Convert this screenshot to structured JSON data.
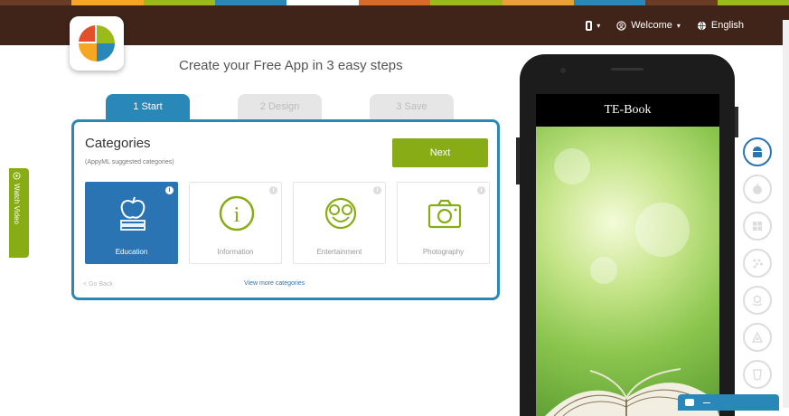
{
  "colors": {
    "stripe": [
      "#6a3c26",
      "#f5a623",
      "#9bbb1a",
      "#2a88b8",
      "#ffffff",
      "#d86a2b",
      "#9bbb1a",
      "#e8a23a",
      "#2a88b8",
      "#6a3c26",
      "#9bbb1a"
    ],
    "topbar": "#40241a",
    "accent_blue": "#2a88b8",
    "accent_green": "#88ad14"
  },
  "header": {
    "device_menu_icon": "phone-icon",
    "welcome_label": "Welcome",
    "language_label": "English"
  },
  "hero": {
    "tagline": "Create your Free App in 3 easy steps"
  },
  "steps": [
    {
      "label": "1 Start"
    },
    {
      "label": "2 Design"
    },
    {
      "label": "3 Save"
    }
  ],
  "categories": {
    "title": "Categories",
    "subtitle": "(AppyML suggested categories)",
    "next_label": "Next",
    "items": [
      {
        "label": "Education",
        "icon": "apple-books-icon",
        "selected": true
      },
      {
        "label": "Information",
        "icon": "info-icon",
        "selected": false
      },
      {
        "label": "Entertainment",
        "icon": "smiley-glasses-icon",
        "selected": false
      },
      {
        "label": "Photography",
        "icon": "camera-icon",
        "selected": false
      }
    ],
    "go_back_label": "< Go Back",
    "view_more_label": "View more categories"
  },
  "side_tab": {
    "label": "Watch Video"
  },
  "phone_preview": {
    "app_title": "TE-Book"
  },
  "platforms": [
    "android-icon",
    "apple-icon",
    "windows-icon",
    "blackberry-icon",
    "amazon-icon",
    "triangle-icon",
    "html5-icon"
  ]
}
